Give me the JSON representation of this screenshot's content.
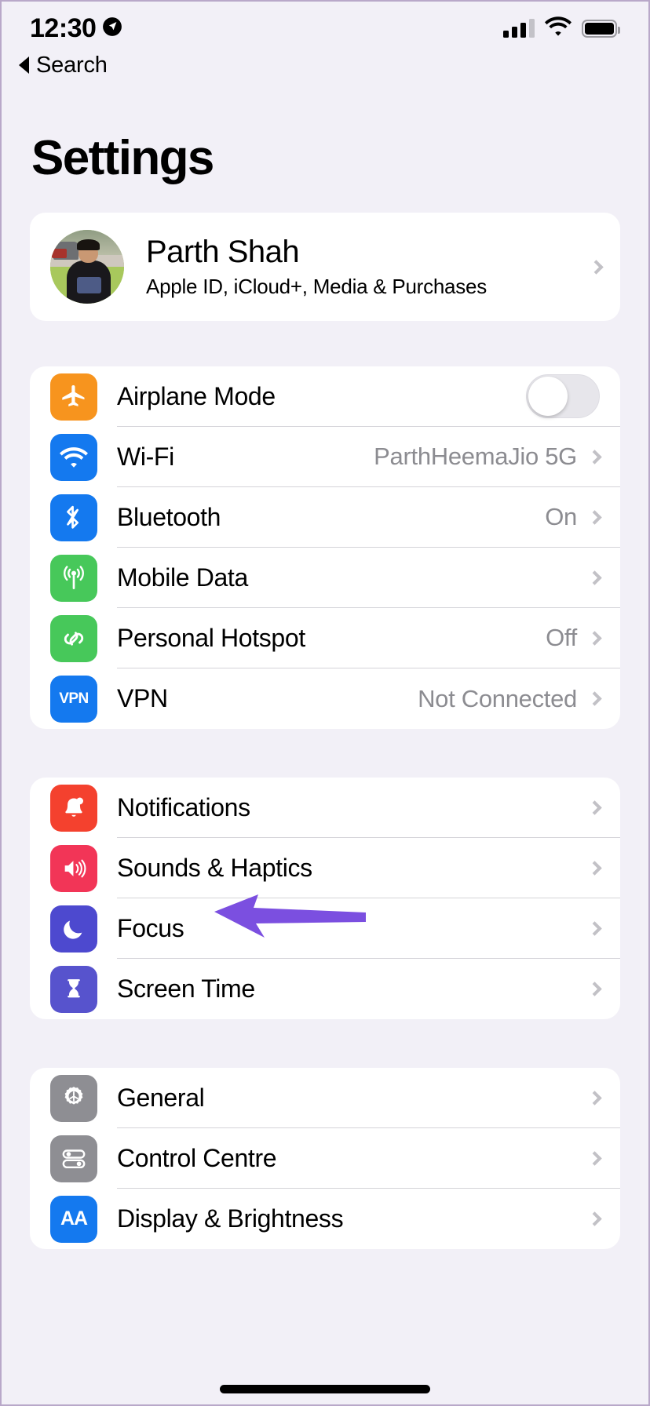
{
  "status_bar": {
    "time": "12:30",
    "location_icon": "location-services-icon",
    "signal_icon": "cellular-signal-icon",
    "signal_bars_filled": 3,
    "signal_bars_total": 4,
    "wifi_icon": "wifi-icon",
    "battery_icon": "battery-full-icon",
    "battery_level_percent": 100
  },
  "back_bar": {
    "label": "Search",
    "icon": "back-triangle-icon"
  },
  "header": {
    "title": "Settings"
  },
  "profile": {
    "name": "Parth Shah",
    "subtitle": "Apple ID, iCloud+, Media & Purchases",
    "avatar_icon": "user-avatar-photo",
    "chevron_icon": "chevron-right-icon"
  },
  "colors": {
    "page_background": "#f2f0f7",
    "card_background": "#ffffff",
    "separator": "#d4d3d8",
    "value_text": "#8c8c91",
    "chevron": "#c2c1c6",
    "annotation_arrow": "#7b4fe0",
    "airplane_orange": "#f7941e",
    "wifi_blue": "#1479ef",
    "bluetooth_blue": "#1479ef",
    "mobiledata_green": "#47c85a",
    "hotspot_green": "#47c85a",
    "vpn_blue": "#1479ef",
    "notifications_red": "#f4412e",
    "sounds_pink": "#f23557",
    "focus_indigo": "#4d49cf",
    "screentime_indigo": "#5753cd",
    "general_gray": "#8e8e93",
    "controlcentre_gray": "#8e8e93",
    "display_blue": "#1479ef"
  },
  "annotation": {
    "type": "arrow",
    "points_to": "Focus",
    "color": "#7b4fe0"
  },
  "groups": [
    {
      "id": "connectivity",
      "rows": [
        {
          "label": "Airplane Mode",
          "icon": "airplane-icon",
          "icon_color": "#f7941e",
          "control": "toggle",
          "toggle_on": false,
          "value": "",
          "chevron": false
        },
        {
          "label": "Wi-Fi",
          "icon": "wifi-icon",
          "icon_color": "#1479ef",
          "control": "value",
          "value": "ParthHeemaJio 5G",
          "chevron": true
        },
        {
          "label": "Bluetooth",
          "icon": "bluetooth-icon",
          "icon_color": "#1479ef",
          "control": "value",
          "value": "On",
          "chevron": true
        },
        {
          "label": "Mobile Data",
          "icon": "cellular-antenna-icon",
          "icon_color": "#47c85a",
          "control": "value",
          "value": "",
          "chevron": true
        },
        {
          "label": "Personal Hotspot",
          "icon": "hotspot-link-icon",
          "icon_color": "#47c85a",
          "control": "value",
          "value": "Off",
          "chevron": true
        },
        {
          "label": "VPN",
          "icon": "vpn-icon",
          "icon_color": "#1479ef",
          "icon_text": "VPN",
          "control": "value",
          "value": "Not Connected",
          "chevron": true
        }
      ]
    },
    {
      "id": "notifications",
      "rows": [
        {
          "label": "Notifications",
          "icon": "bell-icon",
          "icon_color": "#f4412e",
          "control": "value",
          "value": "",
          "chevron": true
        },
        {
          "label": "Sounds & Haptics",
          "icon": "speaker-waves-icon",
          "icon_color": "#f23557",
          "control": "value",
          "value": "",
          "chevron": true
        },
        {
          "label": "Focus",
          "icon": "moon-icon",
          "icon_color": "#4d49cf",
          "control": "value",
          "value": "",
          "chevron": true,
          "annotated": true
        },
        {
          "label": "Screen Time",
          "icon": "hourglass-icon",
          "icon_color": "#5753cd",
          "control": "value",
          "value": "",
          "chevron": true
        }
      ]
    },
    {
      "id": "system",
      "rows": [
        {
          "label": "General",
          "icon": "gear-icon",
          "icon_color": "#8e8e93",
          "control": "value",
          "value": "",
          "chevron": true
        },
        {
          "label": "Control Centre",
          "icon": "sliders-icon",
          "icon_color": "#8e8e93",
          "control": "value",
          "value": "",
          "chevron": true
        },
        {
          "label": "Display & Brightness",
          "icon": "display-aa-icon",
          "icon_color": "#1479ef",
          "icon_text": "AA",
          "control": "value",
          "value": "",
          "chevron": true
        }
      ]
    }
  ],
  "home_indicator": "home-indicator"
}
